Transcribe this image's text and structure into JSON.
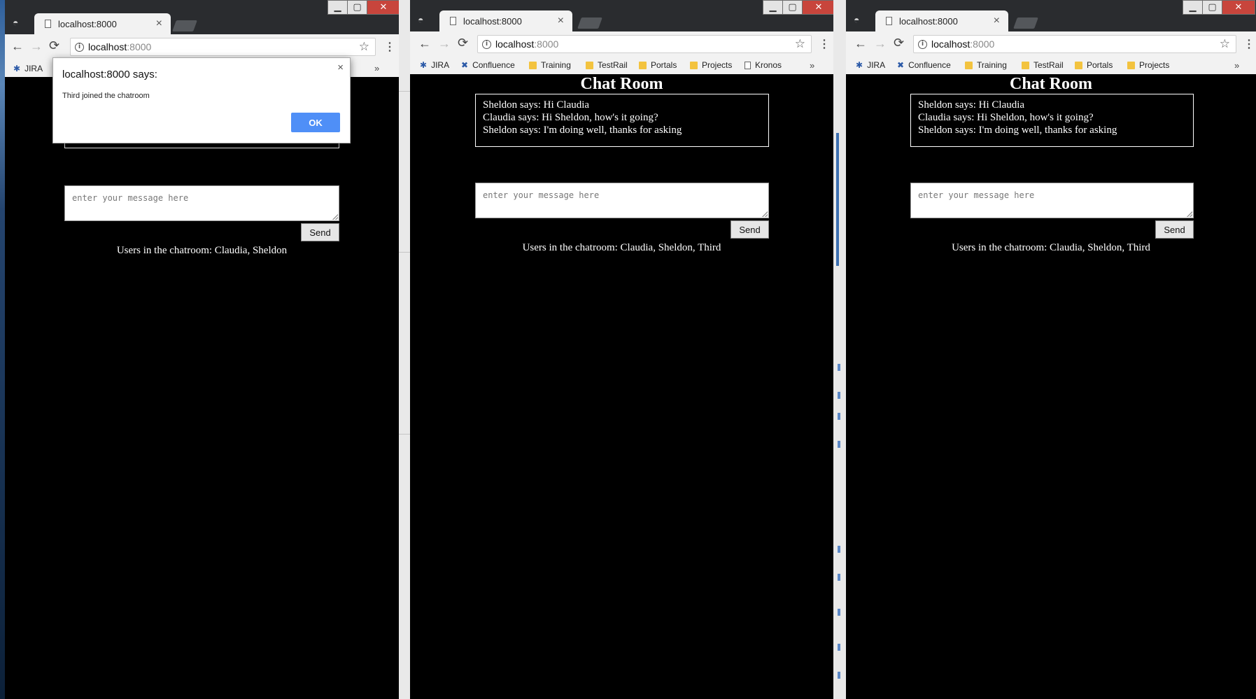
{
  "windows": [
    {
      "tab_title": "localhost:8000",
      "address": {
        "host": "localhost",
        "port": ":8000"
      },
      "bookmarks": [
        {
          "label": "JIRA",
          "icon": "jira-icon"
        }
      ],
      "chat_title": "",
      "messages": [],
      "input_placeholder": "enter your message here",
      "send_label": "Send",
      "users_text": "Users in the chatroom: Claudia, Sheldon",
      "dialog": {
        "title": "localhost:8000 says:",
        "message": "Third joined the chatroom",
        "ok_label": "OK",
        "close_glyph": "×"
      }
    },
    {
      "tab_title": "localhost:8000",
      "address": {
        "host": "localhost",
        "port": ":8000"
      },
      "bookmarks": [
        {
          "label": "JIRA",
          "icon": "jira-icon"
        },
        {
          "label": "Confluence",
          "icon": "confluence-icon"
        },
        {
          "label": "Training",
          "icon": "folder-icon"
        },
        {
          "label": "TestRail",
          "icon": "folder-icon"
        },
        {
          "label": "Portals",
          "icon": "folder-icon"
        },
        {
          "label": "Projects",
          "icon": "folder-icon"
        },
        {
          "label": "Kronos",
          "icon": "page-icon"
        }
      ],
      "chat_title": "Chat Room",
      "messages": [
        "Sheldon says: Hi Claudia",
        "Claudia says: Hi Sheldon, how's it going?",
        "Sheldon says: I'm doing well, thanks for asking"
      ],
      "input_placeholder": "enter your message here",
      "send_label": "Send",
      "users_text": "Users in the chatroom: Claudia, Sheldon, Third"
    },
    {
      "tab_title": "localhost:8000",
      "address": {
        "host": "localhost",
        "port": ":8000"
      },
      "bookmarks": [
        {
          "label": "JIRA",
          "icon": "jira-icon"
        },
        {
          "label": "Confluence",
          "icon": "confluence-icon"
        },
        {
          "label": "Training",
          "icon": "folder-icon"
        },
        {
          "label": "TestRail",
          "icon": "folder-icon"
        },
        {
          "label": "Portals",
          "icon": "folder-icon"
        },
        {
          "label": "Projects",
          "icon": "folder-icon"
        }
      ],
      "chat_title": "Chat Room",
      "messages": [
        "Sheldon says: Hi Claudia",
        "Claudia says: Hi Sheldon, how's it going?",
        "Sheldon says: I'm doing well, thanks for asking"
      ],
      "input_placeholder": "enter your message here",
      "send_label": "Send",
      "users_text": "Users in the chatroom: Claudia, Sheldon, Third"
    }
  ],
  "glyphs": {
    "back": "←",
    "forward": "→",
    "reload": "⟳",
    "info": "i",
    "star": "☆",
    "menu": "⋮",
    "chevron": "»",
    "tab_close": "×",
    "minimize": "▁",
    "maximize": "▢",
    "close": "✕"
  },
  "colors": {
    "page_bg": "#000000",
    "chrome": "#f2f2f2",
    "titlebar": "#2a2c2f",
    "ok_button": "#4f8ff7"
  }
}
